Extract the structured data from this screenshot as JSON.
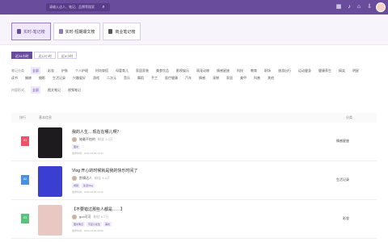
{
  "topbar": {
    "search_placeholder": "请输入达人、笔记、品牌等搜索",
    "search_icon": "search-icon",
    "icons": [
      "grid-icon",
      "bell-icon",
      "cart-icon",
      "download-icon"
    ]
  },
  "tabs": [
    {
      "label": "实时-笔记榜",
      "icon": "doc-icon",
      "active": true
    },
    {
      "label": "实时-短期爆文榜",
      "icon": "doc-icon",
      "active": false
    },
    {
      "label": "商业笔记榜",
      "icon": "doc-icon",
      "active": false
    }
  ],
  "period": [
    "近24小时",
    "近12小时",
    "近6小时"
  ],
  "filters": {
    "category_label": "笔记分类",
    "categories": [
      "全部",
      "彩妆",
      "护肤",
      "个人护理",
      "时尚穿搭",
      "母婴育儿",
      "家居家装",
      "美食饮品",
      "影视娱乐",
      "萌宠动物",
      "情感星座",
      "科技",
      "教育",
      "职场",
      "旅游出行",
      "运动健身",
      "健康养生",
      "搞笑",
      "明星",
      "读书",
      "婚嫁",
      "摄影",
      "生活记录",
      "兴趣爱好",
      "游戏",
      "二次元",
      "音乐",
      "舞蹈",
      "手工",
      "医疗健康",
      "汽车",
      "情感",
      "宠物",
      "家居",
      "美甲",
      "科普",
      "其他"
    ],
    "type_label": "内容形式",
    "types": [
      "全部",
      "图文笔记",
      "视频笔记"
    ]
  },
  "table": {
    "col_rank": "排行",
    "col_info": "基本信息",
    "col_category": "分类"
  },
  "rows": [
    {
      "rank": "01",
      "title": "我的人生... 现在在哪儿啊？",
      "author": "她最不怕的",
      "fans": "粉丝 1.2万",
      "tags": [
        "图文"
      ],
      "meta": "发布时间：2021-04-26 12:34",
      "category": "情感星座",
      "thumb_color": "#1e1b1e"
    },
    {
      "rank": "02",
      "title": "Vlog 开心的时候就是我的快乐时间了",
      "author": "剪辑达人",
      "fans": "粉丝 3.4万",
      "tags": [
        "视频",
        "生活Vlog"
      ],
      "meta": "发布时间：2021-04-26 10:12",
      "category": "生活记录",
      "thumb_color": "#3a3fd1"
    },
    {
      "rank": "03",
      "title": "【不要错过那些人都是……】",
      "author": "guo可可",
      "fans": "粉丝 8.7万",
      "tags": [
        "图文笔记",
        "可爱小女生",
        "美妆"
      ],
      "meta": "发布时间：2021-04-26 09:05",
      "category": "彩妆",
      "thumb_color": "#e9c7c2"
    }
  ]
}
